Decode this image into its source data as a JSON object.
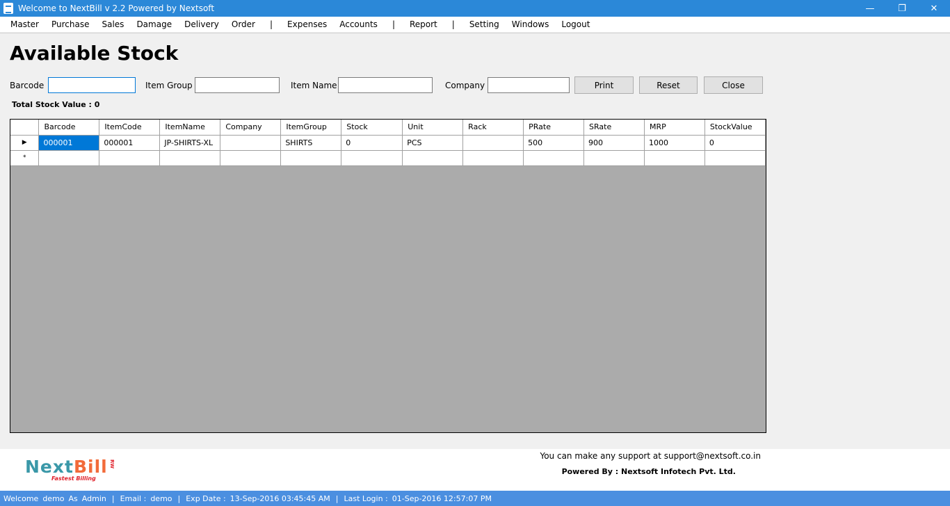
{
  "window": {
    "title": "Welcome to NextBill v 2.2 Powered by Nextsoft",
    "minimize": "—",
    "restore": "❐",
    "close": "✕"
  },
  "menu": {
    "items": [
      "Master",
      "Purchase",
      "Sales",
      "Damage",
      "Delivery",
      "Order",
      "|",
      "Expenses",
      "Accounts",
      "|",
      "Report",
      "|",
      "Setting",
      "Windows",
      "Logout"
    ]
  },
  "page": {
    "title": "Available Stock",
    "total_label": "Total Stock Value : 0"
  },
  "filters": {
    "barcode_label": "Barcode",
    "barcode_value": "",
    "item_group_label": "Item Group",
    "item_group_value": "",
    "item_name_label": "Item Name",
    "item_name_value": "",
    "company_label": "Company",
    "company_value": ""
  },
  "buttons": {
    "print": "Print",
    "reset": "Reset",
    "close": "Close"
  },
  "grid": {
    "columns": [
      "Barcode",
      "ItemCode",
      "ItemName",
      "Company",
      "ItemGroup",
      "Stock",
      "Unit",
      "Rack",
      "PRate",
      "SRate",
      "MRP",
      "StockValue"
    ],
    "rows": [
      [
        "000001",
        "000001",
        "JP-SHIRTS-XL",
        "",
        "SHIRTS",
        "0",
        "PCS",
        "",
        "500",
        "900",
        "1000",
        "0"
      ]
    ],
    "current_row_marker": "▶",
    "new_row_marker": "*"
  },
  "footer": {
    "logo_part1": "Next",
    "logo_part2": "Bill",
    "logo_tagline": "Fastest Billing",
    "logo_badge": "RW",
    "support_text": "You can make any support at support@nextsoft.co.in",
    "powered_by": "Powered By : Nextsoft Infotech Pvt. Ltd."
  },
  "status": {
    "welcome": "Welcome",
    "user": "demo",
    "as": "As",
    "role": "Admin",
    "email_label": "Email :",
    "email_value": "demo",
    "exp_label": "Exp Date :",
    "exp_value": "13-Sep-2016 03:45:45 AM",
    "last_login_label": "Last Login :",
    "last_login_value": "01-Sep-2016 12:57:07 PM"
  },
  "colors": {
    "titlebar": "#2b88d8",
    "statusbar": "#4b8fe0",
    "selection": "#0078d7",
    "grid_background": "#ababab"
  }
}
